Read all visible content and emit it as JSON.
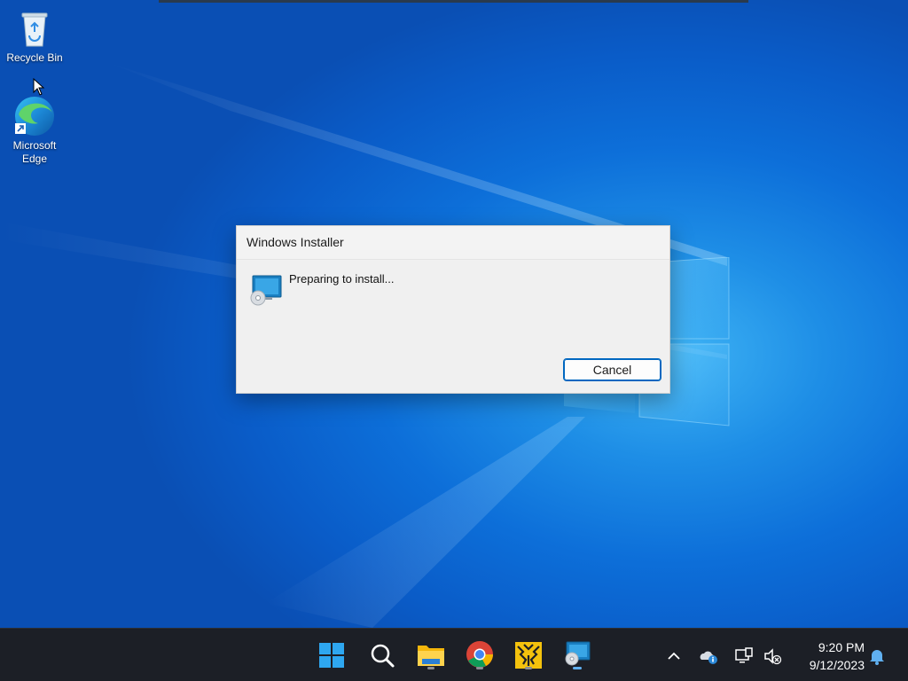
{
  "desktop": {
    "icons": [
      {
        "label": "Recycle Bin",
        "icon": "recycle-bin-icon"
      },
      {
        "label": "Microsoft Edge",
        "icon": "edge-icon"
      }
    ]
  },
  "dialog": {
    "title": "Windows Installer",
    "message": "Preparing to install...",
    "cancel_label": "Cancel",
    "icon": "installer-icon"
  },
  "taskbar": {
    "apps": [
      {
        "name": "start",
        "icon": "windows-start-icon",
        "running": false
      },
      {
        "name": "search",
        "icon": "search-icon",
        "running": false
      },
      {
        "name": "file-explorer",
        "icon": "folder-icon",
        "running": true
      },
      {
        "name": "chrome",
        "icon": "chrome-icon",
        "running": true
      },
      {
        "name": "app",
        "icon": "yellow-app-icon",
        "running": true
      },
      {
        "name": "windows-installer",
        "icon": "installer-icon",
        "running": true,
        "active": true
      }
    ],
    "tray": {
      "icons": [
        "chevron-up-icon",
        "onedrive-icon",
        "network-icon",
        "volume-muted-icon"
      ],
      "time": "9:20 PM",
      "date": "9/12/2023",
      "notification_icon": "bell-icon"
    }
  },
  "colors": {
    "accent": "#0067c0",
    "taskbar": "#1c1f26",
    "wallpaper": "#0a5cc8"
  }
}
